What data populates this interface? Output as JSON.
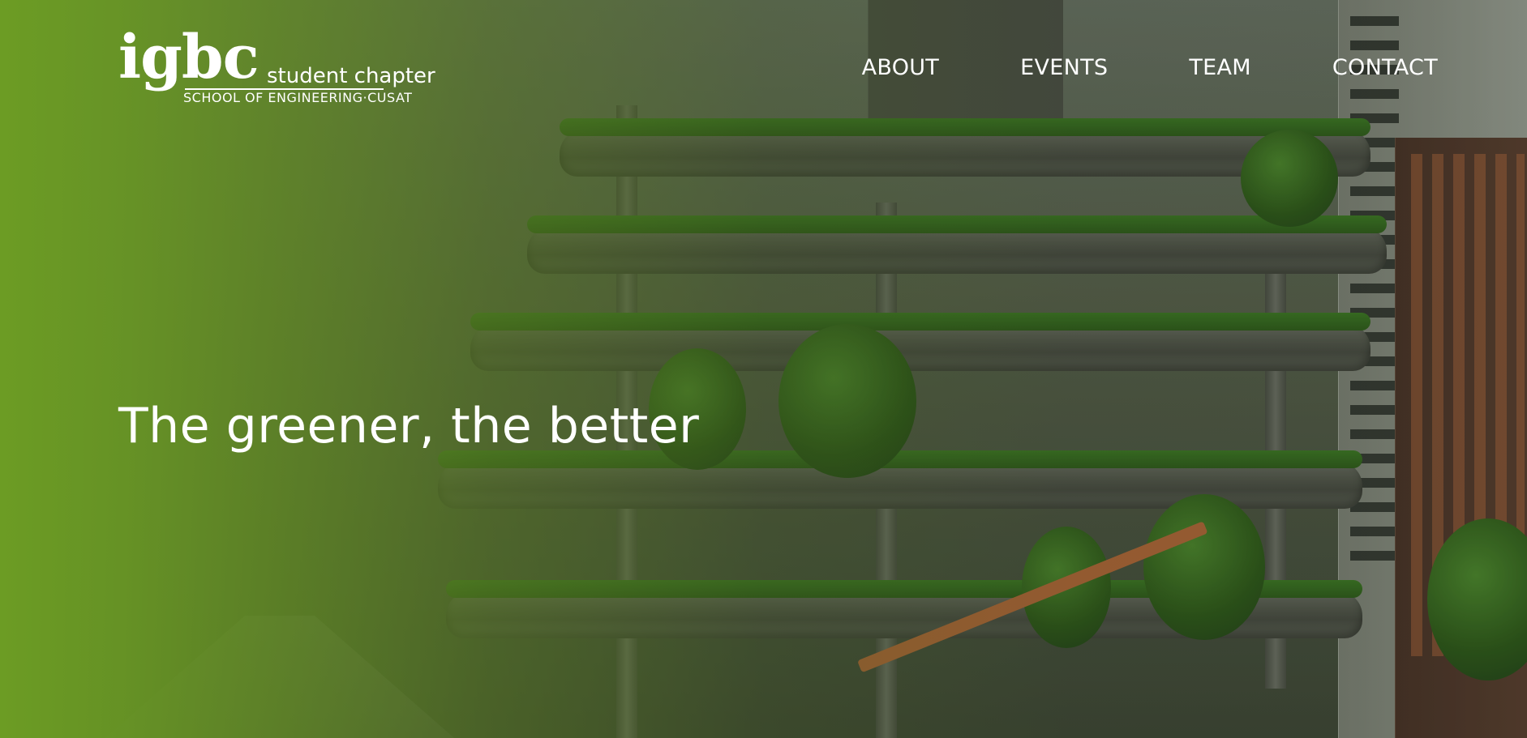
{
  "brand": {
    "logo_mark": "igbc",
    "logo_line1": "student chapter",
    "logo_line2": "SCHOOL OF ENGINEERING·CUSAT"
  },
  "nav": {
    "items": [
      {
        "label": "ABOUT"
      },
      {
        "label": "EVENTS"
      },
      {
        "label": "TEAM"
      },
      {
        "label": "CONTACT"
      }
    ]
  },
  "hero": {
    "tagline": "The greener, the better",
    "background_image": "green-building-photo",
    "overlay_color": "#6c9c24"
  }
}
